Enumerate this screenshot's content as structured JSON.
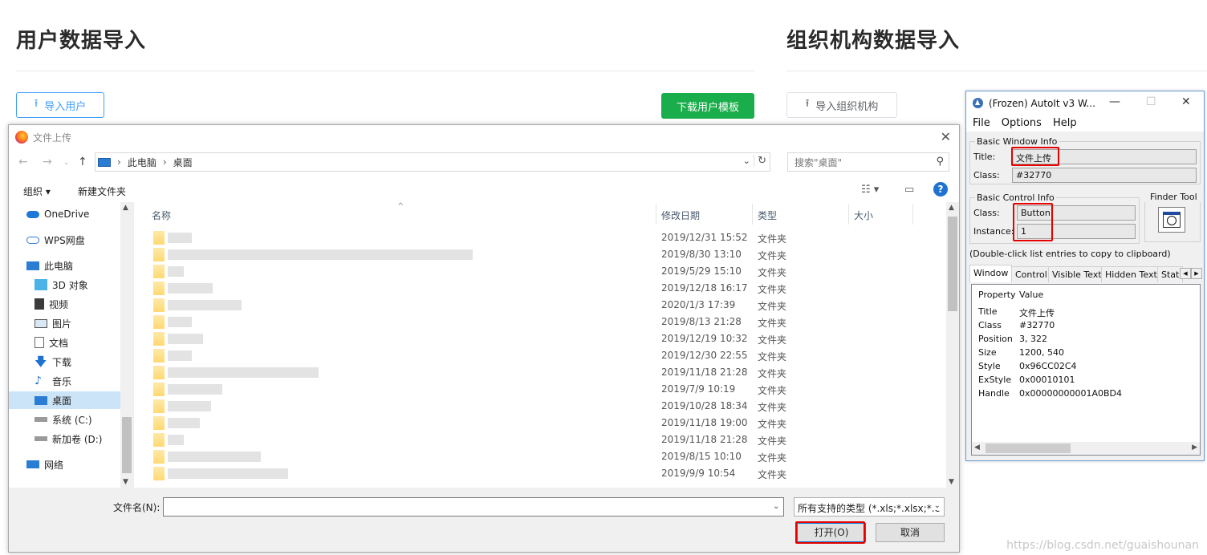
{
  "web": {
    "left_title": "用户数据导入",
    "right_title": "组织机构数据导入",
    "import_users": "导入用户",
    "download_template": "下载用户模板",
    "import_org": "导入组织机构"
  },
  "dialog": {
    "title": "文件上传",
    "path": [
      "此电脑",
      "桌面"
    ],
    "search_placeholder": "搜索\"桌面\"",
    "organize": "组织 ▾",
    "new_folder": "新建文件夹",
    "columns": {
      "name": "名称",
      "date": "修改日期",
      "type": "类型",
      "size": "大小"
    },
    "sidebar": [
      {
        "label": "OneDrive",
        "icon": "cloud-icon"
      },
      {
        "label": "WPS网盘",
        "icon": "cloud-outline-icon"
      },
      {
        "label": "此电脑",
        "icon": "computer-icon"
      },
      {
        "label": "3D 对象",
        "icon": "cube-icon"
      },
      {
        "label": "视频",
        "icon": "film-icon"
      },
      {
        "label": "图片",
        "icon": "picture-icon"
      },
      {
        "label": "文档",
        "icon": "document-icon"
      },
      {
        "label": "下载",
        "icon": "download-arrow-icon"
      },
      {
        "label": "音乐",
        "icon": "music-note-icon"
      },
      {
        "label": "桌面",
        "icon": "desktop-icon"
      },
      {
        "label": "系统 (C:)",
        "icon": "drive-icon"
      },
      {
        "label": "新加卷 (D:)",
        "icon": "drive-icon"
      },
      {
        "label": "网络",
        "icon": "network-icon"
      }
    ],
    "rows": [
      {
        "date": "2019/12/31 15:52",
        "type": "文件夹"
      },
      {
        "date": "2019/8/30 13:10",
        "type": "文件夹"
      },
      {
        "date": "2019/5/29 15:10",
        "type": "文件夹"
      },
      {
        "date": "2019/12/18 16:17",
        "type": "文件夹"
      },
      {
        "date": "2020/1/3 17:39",
        "type": "文件夹"
      },
      {
        "date": "2019/8/13 21:28",
        "type": "文件夹"
      },
      {
        "date": "2019/12/19 10:32",
        "type": "文件夹"
      },
      {
        "date": "2019/12/30 22:55",
        "type": "文件夹"
      },
      {
        "date": "2019/11/18 21:28",
        "type": "文件夹"
      },
      {
        "date": "2019/7/9 10:19",
        "type": "文件夹"
      },
      {
        "date": "2019/10/28 18:34",
        "type": "文件夹"
      },
      {
        "date": "2019/11/18 19:00",
        "type": "文件夹"
      },
      {
        "date": "2019/11/18 21:28",
        "type": "文件夹"
      },
      {
        "date": "2019/8/15 10:10",
        "type": "文件夹"
      },
      {
        "date": "2019/9/9 10:54",
        "type": "文件夹"
      }
    ],
    "filename_label": "文件名(N):",
    "filename_value": "",
    "filetype": "所有支持的类型 (*.xls;*.xlsx;*.c",
    "open_btn": "打开(O)",
    "cancel_btn": "取消"
  },
  "autoit": {
    "title": "(Frozen) AutoIt v3 W...",
    "menu": [
      "File",
      "Options",
      "Help"
    ],
    "basic_window_info": "Basic Window Info",
    "title_label": "Title:",
    "title_value": "文件上传",
    "class_label": "Class:",
    "class_value": "#32770",
    "basic_control_info": "Basic Control Info",
    "ctrl_class_label": "Class:",
    "ctrl_class_value": "Button",
    "instance_label": "Instance:",
    "instance_value": "1",
    "finder_tool": "Finder Tool",
    "hint": "(Double-click list entries to copy to clipboard)",
    "tabs": [
      "Window",
      "Control",
      "Visible Text",
      "Hidden Text",
      "Stat"
    ],
    "prop_header": [
      "Property",
      "Value"
    ],
    "props": [
      [
        "Title",
        "文件上传"
      ],
      [
        "Class",
        "#32770"
      ],
      [
        "Position",
        "3, 322"
      ],
      [
        "Size",
        "1200, 540"
      ],
      [
        "Style",
        "0x96CC02C4"
      ],
      [
        "ExStyle",
        "0x00010101"
      ],
      [
        "Handle",
        "0x00000000001A0BD4"
      ]
    ]
  },
  "watermark": "https://blog.csdn.net/guaishounan",
  "colors": {
    "accent": "#409eff",
    "green": "#1aad4b",
    "highlight": "#e60000",
    "selection": "#cce4f7"
  }
}
